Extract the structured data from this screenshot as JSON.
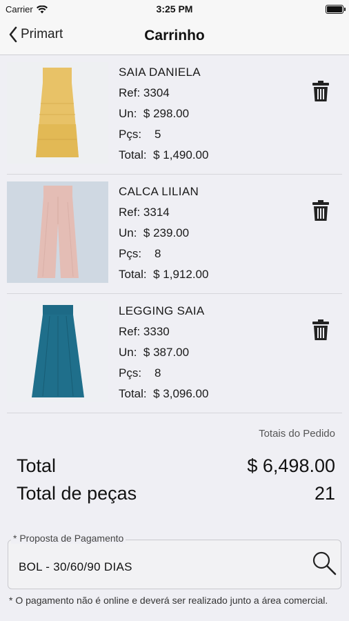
{
  "status_bar": {
    "carrier": "Carrier",
    "time": "3:25 PM"
  },
  "nav": {
    "back_label": "Primart",
    "title": "Carrinho"
  },
  "items": [
    {
      "name": "SAIA DANIELA",
      "ref_label": "Ref:",
      "ref": "3304",
      "unit_label": "Un:",
      "unit_price": "$ 298.00",
      "qty_label": "Pçs:",
      "qty": "5",
      "total_label": "Total:",
      "total": "$ 1,490.00",
      "image_color": "#e8c267"
    },
    {
      "name": "CALCA LILIAN",
      "ref_label": "Ref:",
      "ref": "3314",
      "unit_label": "Un:",
      "unit_price": "$ 239.00",
      "qty_label": "Pçs:",
      "qty": "8",
      "total_label": "Total:",
      "total": "$ 1,912.00",
      "image_color": "#e4bdb5"
    },
    {
      "name": "LEGGING SAIA",
      "ref_label": "Ref:",
      "ref": "3330",
      "unit_label": "Un:",
      "unit_price": "$ 387.00",
      "qty_label": "Pçs:",
      "qty": "8",
      "total_label": "Total:",
      "total": "$ 3,096.00",
      "image_color": "#1f6f8b"
    }
  ],
  "totals": {
    "caption": "Totais do Pedido",
    "total_label": "Total",
    "total_value": "$ 6,498.00",
    "pieces_label": "Total de peças",
    "pieces_value": "21"
  },
  "payment": {
    "legend": "* Proposta de Pagamento",
    "value": "BOL - 30/60/90 DIAS"
  },
  "footnote": "* O pagamento não é online e deverá ser realizado junto a área comercial."
}
